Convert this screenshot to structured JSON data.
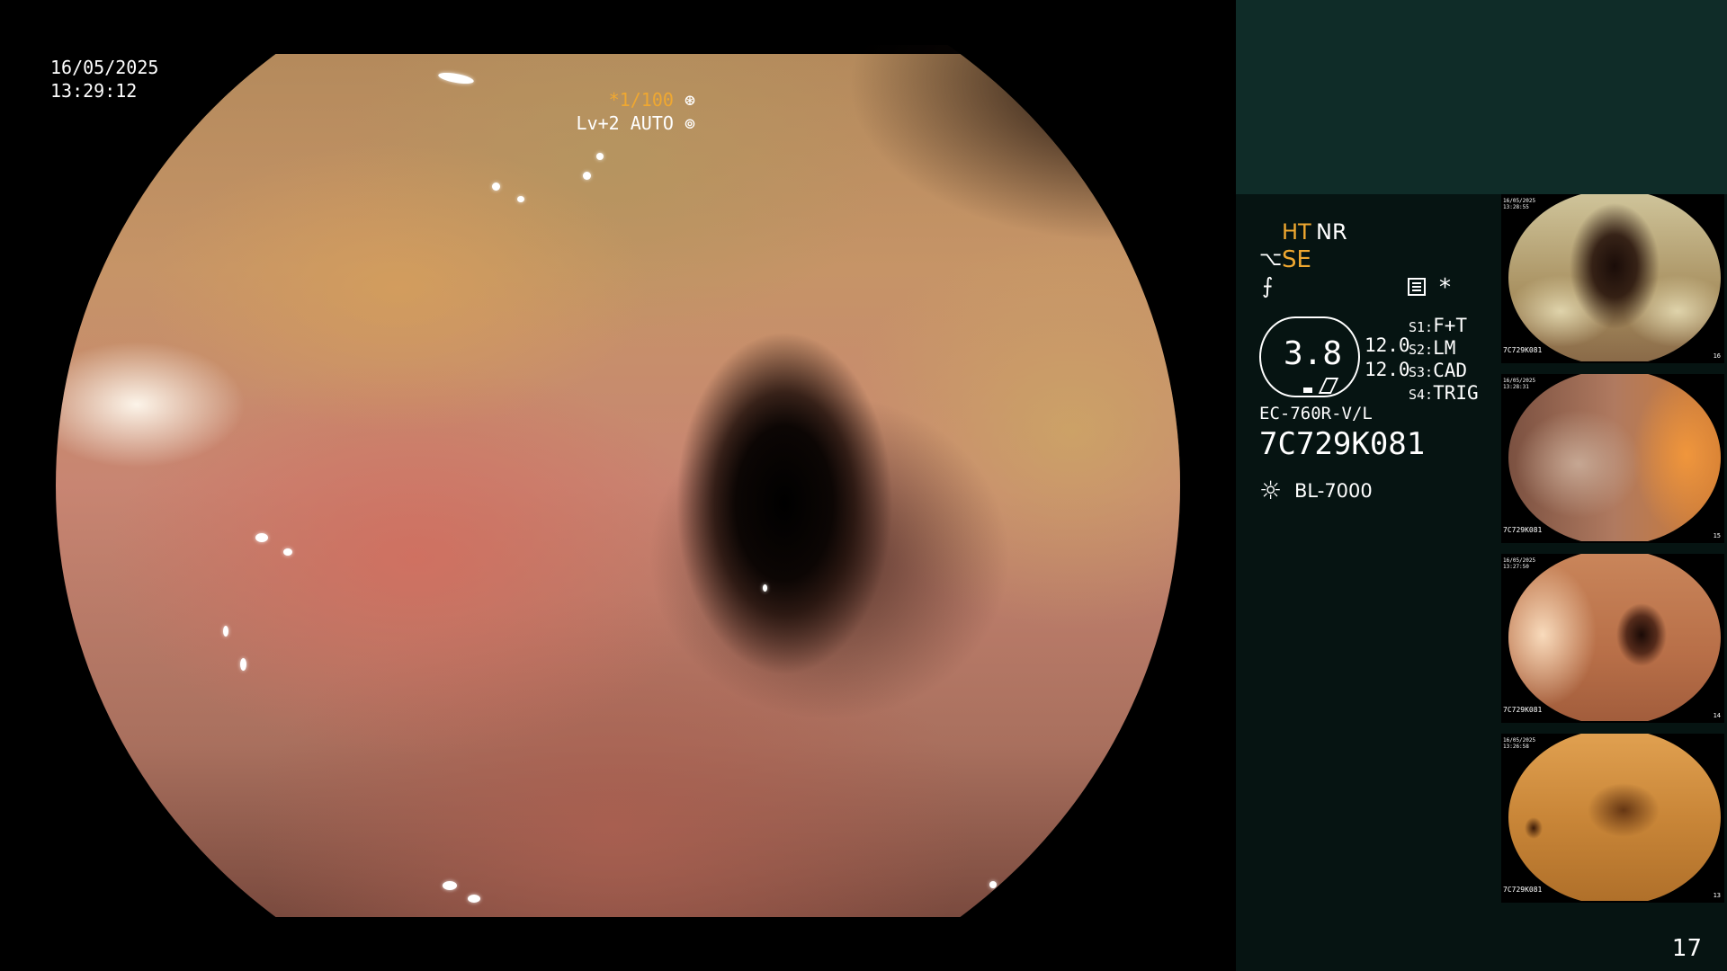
{
  "main": {
    "date": "16/05/2025",
    "time": "13:29:12",
    "shutter_prefix": "*1/100",
    "shutter_icon": "iris-icon",
    "level_label": "Lv+2 AUTO",
    "level_icon": "aperture-icon"
  },
  "panel": {
    "ht": "HT",
    "nr": "NR",
    "se_icon": "⌥",
    "se": "SE",
    "f_icon": "⨍",
    "asterisk": "*",
    "badge_value": "3.8",
    "val1": "12.0",
    "val2": "12.0",
    "scenes": [
      {
        "key": "S1:",
        "value": "F+T"
      },
      {
        "key": "S2:",
        "value": "LM"
      },
      {
        "key": "S3:",
        "value": "CAD"
      },
      {
        "key": "S4:",
        "value": "TRIG"
      }
    ],
    "model": "EC-760R-V/L",
    "serial": "7C729K081",
    "light_icon": "☼",
    "light": "BL-7000"
  },
  "thumbnails": [
    {
      "date": "16/05/2025\n13:28:55",
      "serial": "7C729K081",
      "num": "16"
    },
    {
      "date": "16/05/2025\n13:28:31",
      "serial": "7C729K081",
      "num": "15"
    },
    {
      "date": "16/05/2025\n13:27:50",
      "serial": "7C729K081",
      "num": "14"
    },
    {
      "date": "16/05/2025\n13:26:58",
      "serial": "7C729K081",
      "num": "13"
    }
  ],
  "page_number": "17",
  "colors": {
    "accent_amber": "#f0a830",
    "panel_top": "#0f2c28",
    "panel_bg": "#061412"
  }
}
